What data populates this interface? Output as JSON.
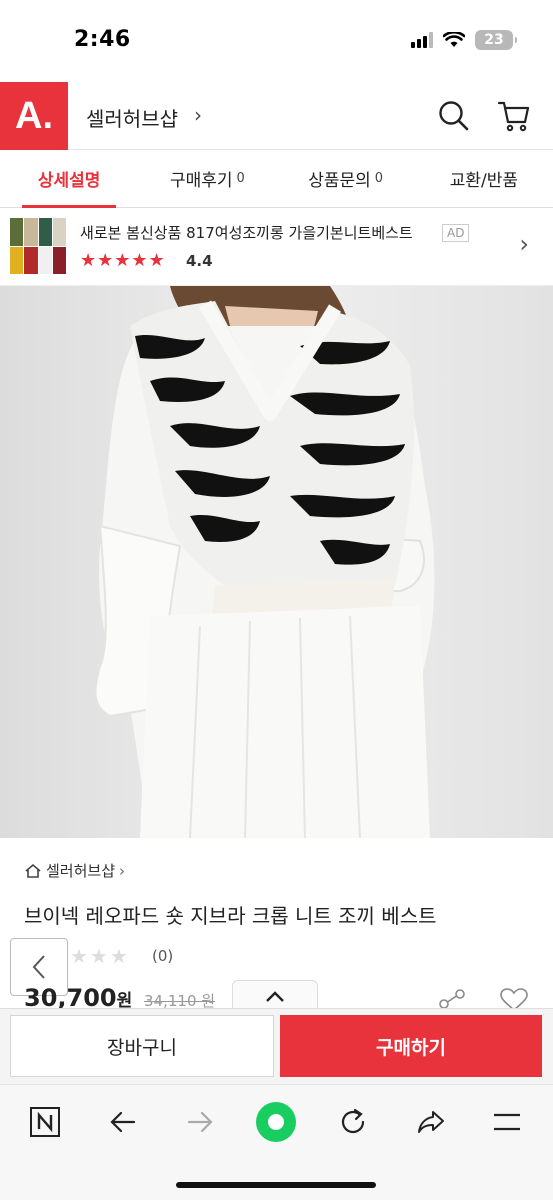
{
  "status_bar": {
    "time": "2:46",
    "battery": "23"
  },
  "header": {
    "logo": "A.",
    "shop_name": "셀러허브샵",
    "chevron": "›",
    "icons": [
      "search-icon",
      "cart-icon"
    ]
  },
  "tabs": [
    {
      "label": "상세설명",
      "count": "",
      "active": true
    },
    {
      "label": "구매후기",
      "count": "0",
      "active": false
    },
    {
      "label": "상품문의",
      "count": "0",
      "active": false
    },
    {
      "label": "교환/반품",
      "count": "",
      "active": false
    }
  ],
  "ad": {
    "title": "새로본 봄신상품 817여성조끼롱 가을기본니트베스트",
    "badge": "AD",
    "stars": "★★★★★",
    "rating": "4.4",
    "thumb_colors": [
      "#5b6e3a",
      "#c9b79a",
      "#2f5d47",
      "#d9d3c4",
      "#e0b020",
      "#b02a2a",
      "#f0f0f0",
      "#8a1f2b"
    ]
  },
  "product": {
    "breadcrumb": "셀러허브샵",
    "title": "브이넥 레오파드 숏 지브라 크롭 니트 조끼 베스트",
    "review_stars": "★★★",
    "review_count": "(0)",
    "price": "30,700",
    "price_unit": "원",
    "original_price": "34,110 원"
  },
  "buy_bar": {
    "cart_label": "장바구니",
    "buy_label": "구매하기"
  },
  "colors": {
    "accent": "#e8323c"
  }
}
